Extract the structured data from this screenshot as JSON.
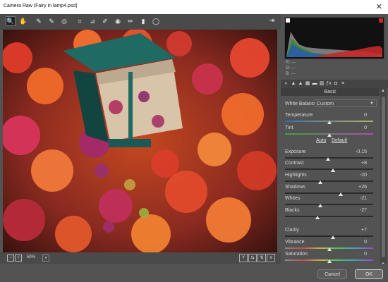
{
  "window": {
    "title": "Camera Raw (Fairy in lamp4.psd)",
    "close_glyph": "✕"
  },
  "toolbar": {
    "tools": [
      {
        "name": "zoom-tool",
        "icon": "magnifier-icon",
        "glyph": "🔍"
      },
      {
        "name": "hand-tool",
        "icon": "hand-icon",
        "glyph": "✋"
      },
      {
        "name": "white-balance-tool",
        "icon": "eyedropper-icon",
        "glyph": "✎"
      },
      {
        "name": "color-sampler-tool",
        "icon": "eyedropper-plus-icon",
        "glyph": "✎"
      },
      {
        "name": "targeted-adjustment-tool",
        "icon": "target-icon",
        "glyph": "◎"
      },
      {
        "name": "crop-tool",
        "icon": "crop-icon",
        "glyph": "⌗"
      },
      {
        "name": "straighten-tool",
        "icon": "straighten-icon",
        "glyph": "⊿"
      },
      {
        "name": "spot-removal-tool",
        "icon": "brush-icon",
        "glyph": "✐"
      },
      {
        "name": "red-eye-tool",
        "icon": "eye-icon",
        "glyph": "◉"
      },
      {
        "name": "adjustment-brush-tool",
        "icon": "brush-icon",
        "glyph": "✏"
      },
      {
        "name": "graduated-filter-tool",
        "icon": "gradient-icon",
        "glyph": "▮"
      },
      {
        "name": "radial-filter-tool",
        "icon": "ellipse-icon",
        "glyph": "◯"
      }
    ],
    "export_icon": "⇥"
  },
  "bottom_bar": {
    "zoom_minus": "−",
    "zoom_plus": "+",
    "zoom_value": "50%",
    "zoom_dropdown": "▾",
    "view_buttons": [
      {
        "name": "before-after-toggle-button",
        "glyph": "Y"
      },
      {
        "name": "before-after-swap-button",
        "glyph": "⇆"
      },
      {
        "name": "copy-settings-button",
        "glyph": "⇅"
      },
      {
        "name": "panel-settings-button",
        "glyph": "≡"
      }
    ]
  },
  "histogram": {
    "r_label": "R:",
    "g_label": "G:",
    "b_label": "B:",
    "r_val": "---",
    "g_val": "---",
    "b_val": "---"
  },
  "panel_tabs": [
    "◐",
    "▲",
    "▲",
    "▦",
    "▬",
    "▥",
    "ƒx",
    "◘",
    "≡"
  ],
  "basic": {
    "header": "Basic",
    "white_balance_label": "White Balance:",
    "white_balance_value": "Custom",
    "auto": "Auto",
    "default": "Default",
    "controls": [
      {
        "label": "Temperature",
        "value": "0",
        "pos": 0.5,
        "track": "grad-temp"
      },
      {
        "label": "Tint",
        "value": "0",
        "pos": 0.5,
        "track": "grad-tint"
      },
      {
        "label": "Exposure",
        "value": "-0.15",
        "pos": 0.49,
        "track": ""
      },
      {
        "label": "Contrast",
        "value": "+8",
        "pos": 0.54,
        "track": ""
      },
      {
        "label": "Highlights",
        "value": "-20",
        "pos": 0.4,
        "track": ""
      },
      {
        "label": "Shadows",
        "value": "+26",
        "pos": 0.63,
        "track": ""
      },
      {
        "label": "Whites",
        "value": "-21",
        "pos": 0.4,
        "track": ""
      },
      {
        "label": "Blacks",
        "value": "-27",
        "pos": 0.37,
        "track": ""
      },
      {
        "label": "Clarity",
        "value": "+7",
        "pos": 0.54,
        "track": ""
      },
      {
        "label": "Vibrance",
        "value": "0",
        "pos": 0.5,
        "track": "grad-vib"
      },
      {
        "label": "Saturation",
        "value": "0",
        "pos": 0.5,
        "track": "grad-sat"
      }
    ]
  },
  "footer": {
    "cancel": "Cancel",
    "ok": "OK"
  }
}
